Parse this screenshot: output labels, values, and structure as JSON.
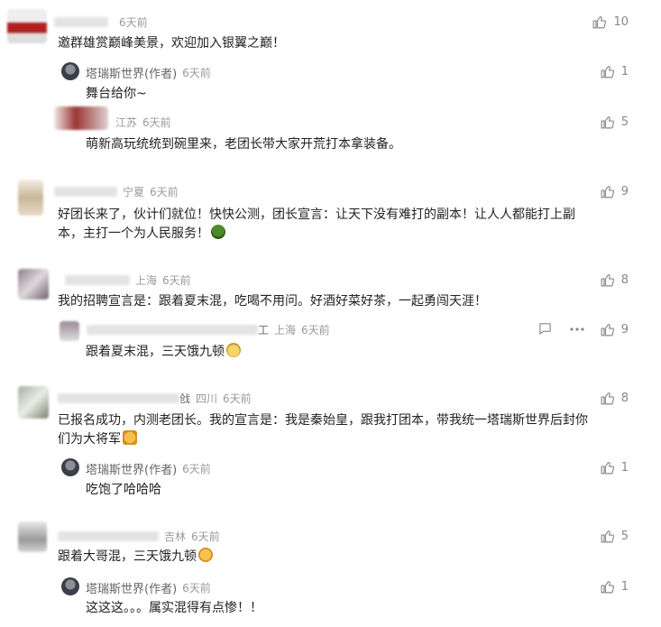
{
  "comments": [
    {
      "loc": "",
      "time": "6天前",
      "text": "邀群雄赏巅峰美景，欢迎加入银翼之巅！",
      "likes": "10"
    },
    {
      "author": "塔瑞斯世界(作者)",
      "time": "6天前",
      "text": "舞台给你~",
      "likes": "1"
    },
    {
      "loc": "江苏",
      "time": "6天前",
      "text": "萌新高玩统统到碗里来，老团长带大家开荒打本拿装备。",
      "likes": "5"
    },
    {
      "loc": "宁夏",
      "time": "6天前",
      "text1": "好团长来了，伙计们就位！快快公测，团长宣言：让天下没有难打的副本！让人人都能打上副",
      "text2": "本，主打一个为人民服务！",
      "likes": "9"
    },
    {
      "loc": "上海",
      "time": "6天前",
      "text": "我的招聘宣言是：跟着夏末混，吃喝不用问。好酒好菜好茶，一起勇闯天涯！",
      "likes": "8"
    },
    {
      "name_tail": "工",
      "loc": "上海",
      "time": "6天前",
      "text": "跟着夏末混，三天饿九顿",
      "likes": "9"
    },
    {
      "name_tail": "戗",
      "loc": "四川",
      "time": "6天前",
      "text1": "已报名成功，内测老团长。我的宣言是：我是秦始皇，跟我打团本，带我统一塔瑞斯世界后封你",
      "text2": "们为大将军",
      "likes": "8"
    },
    {
      "author": "塔瑞斯世界(作者)",
      "time": "6天前",
      "text": "吃饱了哈哈哈",
      "likes": "1"
    },
    {
      "loc": "吉林",
      "time": "6天前",
      "text": "跟着大哥混，三天饿九顿",
      "likes": "5"
    },
    {
      "author": "塔瑞斯世界(作者)",
      "time": "6天前",
      "text": "这这这。。。属实混得有点惨！！",
      "likes": "1"
    }
  ],
  "icons": {
    "like": "thumbs-up-icon",
    "reply": "reply-icon",
    "more": "more-icon"
  },
  "colors": {
    "meta": "#9a9a9a",
    "text": "#222222"
  }
}
